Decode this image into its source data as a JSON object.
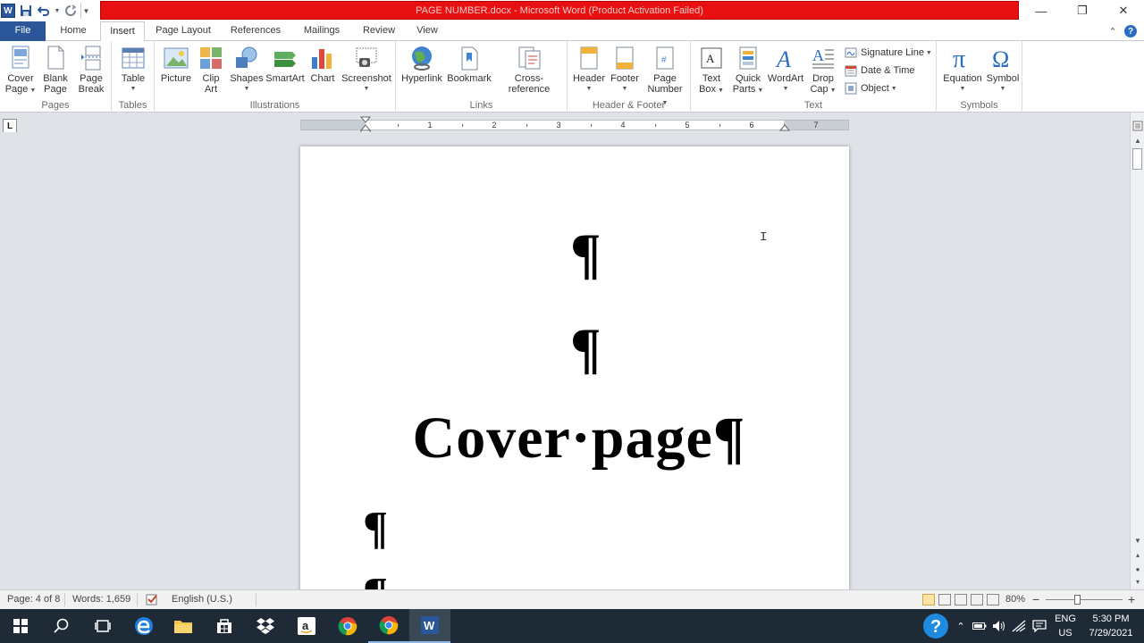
{
  "window": {
    "title": "PAGE NUMBER.docx - Microsoft Word (Product Activation Failed)",
    "controls": {
      "minimize": "—",
      "restore": "❐",
      "close": "✕"
    }
  },
  "tabs": [
    {
      "label": "File"
    },
    {
      "label": "Home"
    },
    {
      "label": "Insert",
      "active": true
    },
    {
      "label": "Page Layout"
    },
    {
      "label": "References"
    },
    {
      "label": "Mailings"
    },
    {
      "label": "Review"
    },
    {
      "label": "View"
    }
  ],
  "ribbon": {
    "pages": {
      "label": "Pages",
      "cover_1": "Cover",
      "cover_2": "Page",
      "blank_1": "Blank",
      "blank_2": "Page",
      "break_1": "Page",
      "break_2": "Break"
    },
    "tables": {
      "label": "Tables",
      "table": "Table"
    },
    "illustrations": {
      "label": "Illustrations",
      "picture": "Picture",
      "clipart_1": "Clip",
      "clipart_2": "Art",
      "shapes": "Shapes",
      "smartart": "SmartArt",
      "chart": "Chart",
      "screenshot": "Screenshot"
    },
    "links": {
      "label": "Links",
      "hyperlink": "Hyperlink",
      "bookmark": "Bookmark",
      "crossref": "Cross-reference"
    },
    "headerfooter": {
      "label": "Header & Footer",
      "header": "Header",
      "footer": "Footer",
      "pagenum_1": "Page",
      "pagenum_2": "Number"
    },
    "text": {
      "label": "Text",
      "textbox_1": "Text",
      "textbox_2": "Box",
      "quickparts_1": "Quick",
      "quickparts_2": "Parts",
      "wordart": "WordArt",
      "dropcap_1": "Drop",
      "dropcap_2": "Cap",
      "signature": "Signature Line",
      "datetime": "Date & Time",
      "object": "Object"
    },
    "symbols": {
      "label": "Symbols",
      "equation": "Equation",
      "symbol": "Symbol"
    }
  },
  "ruler": {
    "numbers": [
      "1",
      "2",
      "3",
      "4",
      "5",
      "6",
      "7"
    ]
  },
  "document": {
    "pilcrow": "¶",
    "heading": "Cover·page¶"
  },
  "status": {
    "page": "Page: 4 of 8",
    "words": "Words: 1,659",
    "language": "English (U.S.)",
    "zoom": "80%",
    "zoom_minus": "−",
    "zoom_plus": "+"
  },
  "taskbar": {
    "lang_1": "ENG",
    "lang_2": "US",
    "time": "5:30 PM",
    "date": "7/29/2021"
  },
  "colors": {
    "title_red": "#e81010",
    "file_tab": "#2b579a",
    "taskbar": "#1e2a36"
  }
}
